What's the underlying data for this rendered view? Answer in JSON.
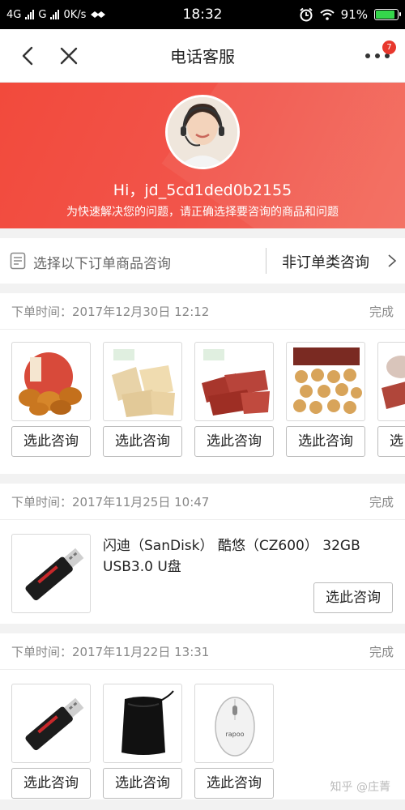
{
  "status_bar": {
    "left": "4G",
    "carrier2": "G",
    "speed": "0K/s",
    "time": "18:32",
    "battery": "91%"
  },
  "nav": {
    "title": "电话客服",
    "badge": "7"
  },
  "hero": {
    "greeting": "Hi，jd_5cd1ded0b2155",
    "subtitle": "为快速解决您的问题，请正确选择要咨询的商品和问题"
  },
  "chooser": {
    "left_label": "选择以下订单商品咨询",
    "right_label": "非订单类咨询"
  },
  "orders": [
    {
      "time_label": "下单时间：2017年12月30日 12:12",
      "status": "完成",
      "button_label": "选此咨询"
    },
    {
      "time_label": "下单时间：2017年11月25日 10:47",
      "status": "完成",
      "product_title": "闪迪（SanDisk） 酷悠（CZ600） 32GB USB3.0 U盘",
      "button_label": "选此咨询"
    },
    {
      "time_label": "下单时间：2017年11月22日 13:31",
      "status": "完成",
      "button_label": "选此咨询"
    }
  ],
  "watermark": "知乎 @庄菁",
  "colors": {
    "brand_red": "#f24a3c",
    "badge_red": "#e8382d"
  }
}
